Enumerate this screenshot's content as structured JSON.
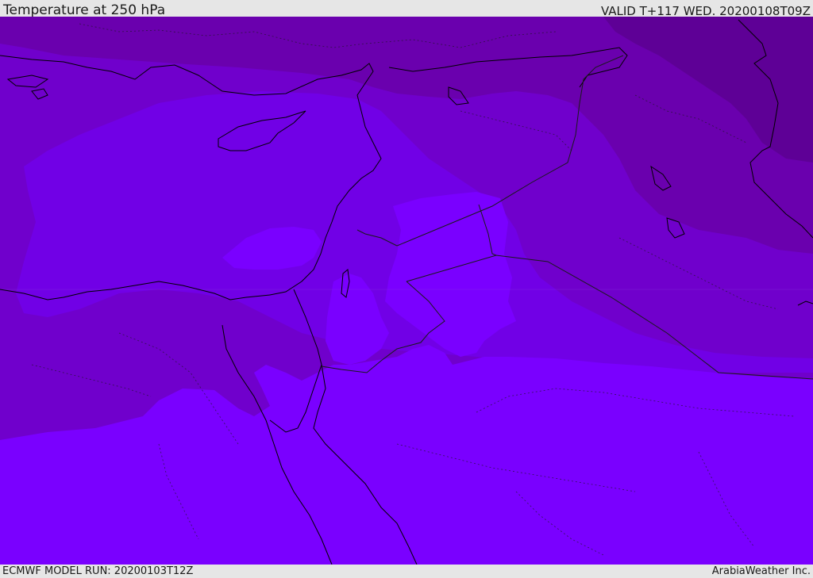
{
  "header": {
    "title": "Temperature at 250 hPa",
    "valid": "VALID T+117 WED. 20200108T09Z"
  },
  "footer": {
    "model_run": "ECMWF MODEL RUN: 20200103T12Z",
    "credit": "ArabiaWeather Inc."
  },
  "map": {
    "variable": "Temperature",
    "level": "250 hPa",
    "colors": {
      "warmest": "#7a00ff",
      "warm": "#7100e6",
      "mid": "#7000cc",
      "cool": "#6a00ae",
      "coldest": "#5e0096",
      "coastline": "#000000",
      "border": "#1a1a1a"
    }
  }
}
